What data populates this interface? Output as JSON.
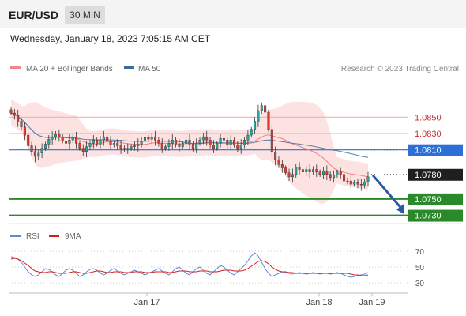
{
  "header": {
    "symbol": "EUR/USD",
    "timeframe": "30 MIN"
  },
  "date_line": "Wednesday, January 18, 2023 7:05:15 AM CET",
  "colors": {
    "bb": "#ef8f8f",
    "ma50": "#5a7da8",
    "up": "#26a69a",
    "down": "#e0392d",
    "support": "#2a8a2a",
    "pivot": "#2d6fd6",
    "rsi": "#5b8bd6",
    "rsi_ma": "#d32020"
  },
  "chart_data": [
    {
      "type": "candlestick",
      "title": "",
      "legend": [
        {
          "label": "MA 20 + Bollinger Bands",
          "color": "#f08888"
        },
        {
          "label": "MA 50",
          "color": "#3d6aa0"
        }
      ],
      "credit": "Research © 2023 Trading Central",
      "ylim": [
        1.0718,
        1.0885
      ],
      "levels": [
        {
          "value": 1.085,
          "label": "1.0850",
          "kind": "resistance"
        },
        {
          "value": 1.083,
          "label": "1.0830",
          "kind": "resistance"
        },
        {
          "value": 1.081,
          "label": "1.0810",
          "kind": "pivot"
        },
        {
          "value": 1.078,
          "label": "1.0780",
          "kind": "current"
        },
        {
          "value": 1.075,
          "label": "1.0750",
          "kind": "support"
        },
        {
          "value": 1.073,
          "label": "1.0730",
          "kind": "support"
        }
      ],
      "x_labels": [
        "Jan 17",
        "Jan 18",
        "Jan 19"
      ],
      "candles_approx_close": [
        1.0855,
        1.0852,
        1.0845,
        1.0838,
        1.0828,
        1.0815,
        1.0808,
        1.0802,
        1.0806,
        1.0812,
        1.0817,
        1.0823,
        1.0826,
        1.0829,
        1.0826,
        1.0821,
        1.0818,
        1.0822,
        1.0826,
        1.0818,
        1.0812,
        1.0808,
        1.0814,
        1.0818,
        1.0822,
        1.0817,
        1.0822,
        1.0826,
        1.0821,
        1.0816,
        1.0818,
        1.0815,
        1.0812,
        1.0811,
        1.0812,
        1.0814,
        1.0815,
        1.0817,
        1.0821,
        1.0825,
        1.0823,
        1.0826,
        1.0822,
        1.0818,
        1.0812,
        1.0814,
        1.0818,
        1.0822,
        1.0817,
        1.0814,
        1.0818,
        1.0822,
        1.0817,
        1.0812,
        1.0818,
        1.0822,
        1.0826,
        1.0822,
        1.0816,
        1.0812,
        1.0818,
        1.0824,
        1.0822,
        1.0816,
        1.0822,
        1.0816,
        1.0812,
        1.0816,
        1.0822,
        1.0828,
        1.0835,
        1.0845,
        1.0858,
        1.0864,
        1.0856,
        1.0835,
        1.0807,
        1.0798,
        1.0792,
        1.0788,
        1.0782,
        1.0777,
        1.078,
        1.0789,
        1.0786,
        1.0783,
        1.0786,
        1.0783,
        1.0786,
        1.0783,
        1.078,
        1.0784,
        1.078,
        1.0776,
        1.0779,
        1.0783,
        1.078,
        1.0772,
        1.0772,
        1.0768,
        1.077,
        1.0768,
        1.0767,
        1.0771,
        1.0777
      ],
      "forecast_arrow": {
        "from": 1.0779,
        "to": 1.0735
      }
    },
    {
      "type": "line",
      "title": "",
      "legend": [
        {
          "label": "RSI",
          "color": "#5b8bd6"
        },
        {
          "label": "9MA",
          "color": "#d32020"
        }
      ],
      "ylim": [
        20,
        80
      ],
      "y_ticks": [
        70,
        50,
        30
      ],
      "rsi_approx": [
        63,
        62,
        60,
        56,
        50,
        44,
        40,
        38,
        40,
        44,
        48,
        47,
        44,
        40,
        38,
        42,
        46,
        48,
        46,
        42,
        38,
        40,
        44,
        47,
        48,
        46,
        42,
        40,
        42,
        46,
        48,
        45,
        42,
        40,
        42,
        44,
        46,
        44,
        42,
        40,
        42,
        44,
        46,
        48,
        45,
        42,
        40,
        44,
        48,
        50,
        46,
        42,
        40,
        44,
        48,
        50,
        46,
        42,
        40,
        44,
        48,
        52,
        50,
        46,
        42,
        40,
        44,
        48,
        52,
        58,
        64,
        68,
        64,
        56,
        48,
        42,
        38,
        40,
        42,
        44,
        43,
        42,
        41,
        42,
        43,
        42,
        41,
        42,
        43,
        42,
        41,
        42,
        42,
        41,
        42,
        43,
        42,
        40,
        38,
        37,
        38,
        39,
        40,
        41,
        43
      ],
      "ma_approx": [
        60,
        61,
        60,
        58,
        55,
        52,
        48,
        45,
        44,
        43,
        43,
        44,
        44,
        43,
        42,
        42,
        42,
        43,
        44,
        44,
        43,
        42,
        42,
        43,
        44,
        45,
        45,
        44,
        43,
        43,
        44,
        44,
        44,
        43,
        43,
        43,
        44,
        44,
        44,
        43,
        43,
        43,
        44,
        44,
        44,
        44,
        43,
        43,
        44,
        45,
        45,
        45,
        44,
        44,
        44,
        45,
        45,
        45,
        44,
        44,
        44,
        45,
        46,
        46,
        46,
        45,
        45,
        45,
        46,
        48,
        51,
        54,
        57,
        58,
        57,
        54,
        50,
        47,
        45,
        44,
        44,
        43,
        43,
        42,
        42,
        42,
        42,
        42,
        42,
        42,
        42,
        42,
        42,
        42,
        42,
        42,
        42,
        42,
        42,
        41,
        40,
        40,
        39,
        39,
        40
      ]
    }
  ]
}
